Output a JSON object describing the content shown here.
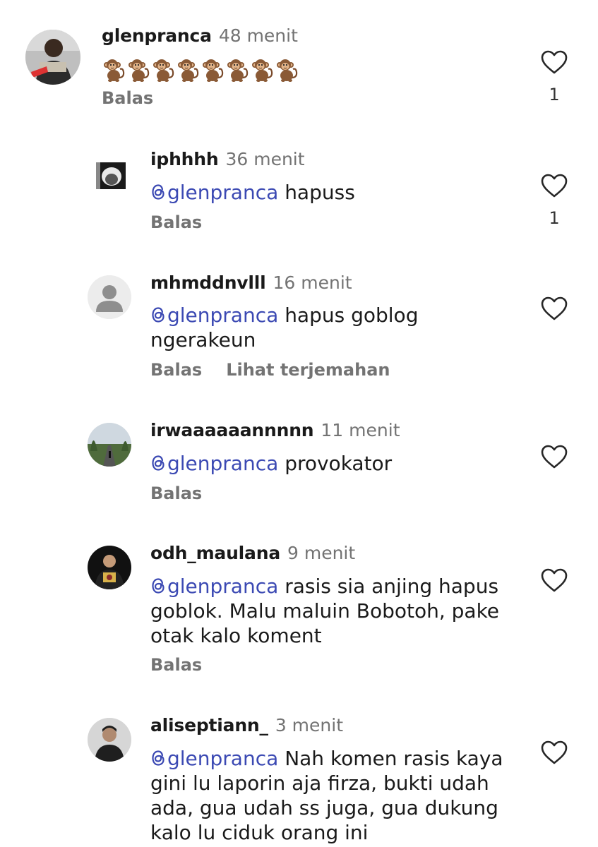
{
  "comments": [
    {
      "username": "glenpranca",
      "time": "48 menit",
      "emoji": [
        "🐒",
        "🐒",
        "🐒",
        "🐒",
        "🐒",
        "🐒",
        "🐒",
        "🐒"
      ],
      "actions": {
        "reply": "Balas"
      },
      "likes": "1"
    },
    {
      "username": "iphhhh",
      "time": "36 menit",
      "mention": "glenpranca",
      "text": "hapuss",
      "actions": {
        "reply": "Balas"
      },
      "likes": "1"
    },
    {
      "username": "mhmddnvlll",
      "time": "16 menit",
      "mention": "glenpranca",
      "text": "hapus goblog ngerakeun",
      "actions": {
        "reply": "Balas",
        "translate": "Lihat terjemahan"
      }
    },
    {
      "username": "irwaaaaaannnnn",
      "time": "11 menit",
      "mention": "glenpranca",
      "text": "provokator",
      "actions": {
        "reply": "Balas"
      }
    },
    {
      "username": "odh_maulana",
      "time": "9 menit",
      "mention": "glenpranca",
      "text": "rasis sia anjing hapus goblok. Malu maluin Bobotoh, pake otak kalo koment",
      "actions": {
        "reply": "Balas"
      }
    },
    {
      "username": "aliseptiann_",
      "time": "3 menit",
      "mention": "glenpranca",
      "text": "Nah komen rasis kaya gini lu laporin aja firza, bukti udah ada, gua udah ss juga, gua dukung kalo lu ciduk orang ini"
    }
  ],
  "colors": {
    "mention": "#3b49b3",
    "muted": "#737373",
    "text": "#1a1a1a"
  },
  "icons": {
    "like": "heart-outline-icon",
    "mention": "threads-at-icon"
  }
}
